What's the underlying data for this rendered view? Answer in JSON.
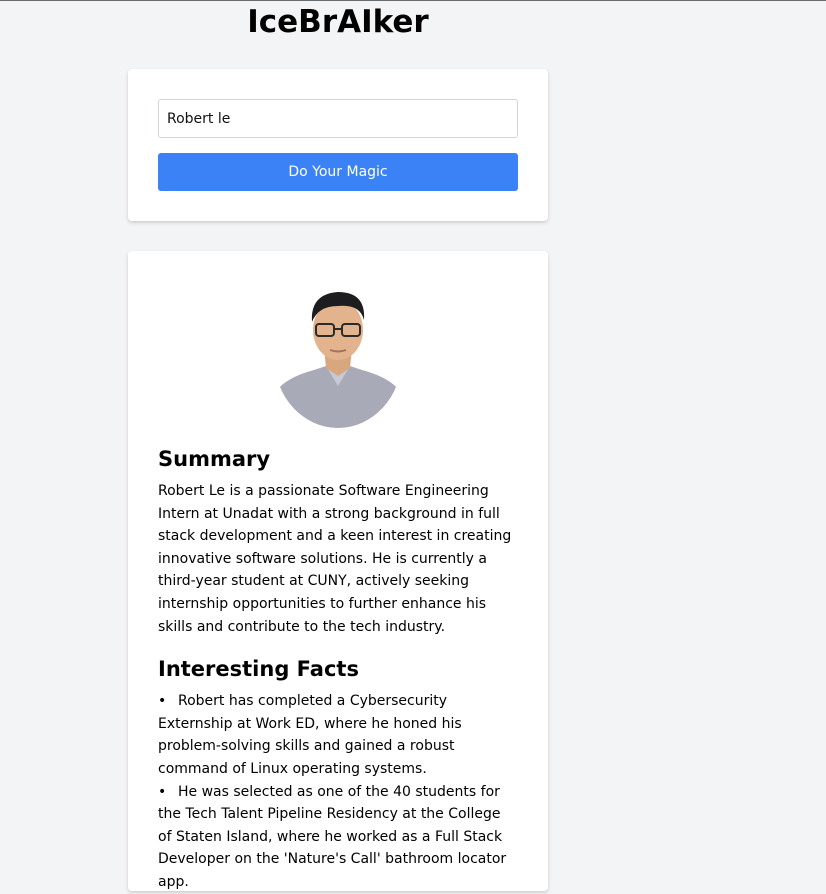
{
  "app": {
    "title": "IceBrAIker"
  },
  "search": {
    "value": "Robert le",
    "button_label": "Do Your Magic"
  },
  "profile": {
    "summary_heading": "Summary",
    "summary": "Robert Le is a passionate Software Engineering Intern at Unadat with a strong background in full stack development and a keen interest in creating innovative software solutions. He is currently a third-year student at CUNY, actively seeking internship opportunities to further enhance his skills and contribute to the tech industry.",
    "facts_heading": "Interesting Facts",
    "facts": [
      "Robert has completed a Cybersecurity Externship at Work ED, where he honed his problem-solving skills and gained a robust command of Linux operating systems.",
      "He was selected as one of the 40 students for the Tech Talent Pipeline Residency at the College of Staten Island, where he worked as a Full Stack Developer on the 'Nature's Call' bathroom locator app."
    ]
  },
  "colors": {
    "background": "#f3f4f6",
    "button": "#3b82f6",
    "card": "#ffffff"
  }
}
